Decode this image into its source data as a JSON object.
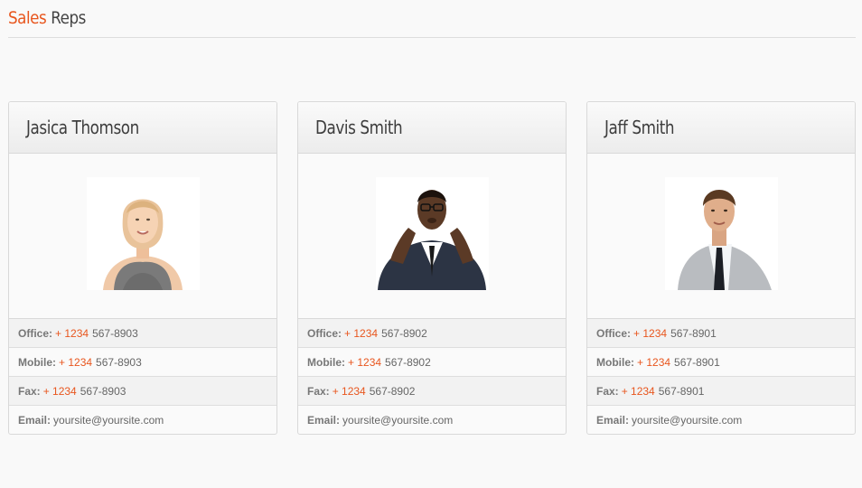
{
  "header": {
    "title_accent": "Sales",
    "title_rest": "Reps"
  },
  "labels": {
    "office": "Office:",
    "mobile": "Mobile:",
    "fax": "Fax:",
    "email": "Email:"
  },
  "reps": [
    {
      "name": "Jasica Thomson",
      "office": {
        "prefix": "+ 1234",
        "number": "567-8903"
      },
      "mobile": {
        "prefix": "+ 1234",
        "number": "567-8903"
      },
      "fax": {
        "prefix": "+ 1234",
        "number": "567-8903"
      },
      "email": "yoursite@yoursite.com"
    },
    {
      "name": "Davis Smith",
      "office": {
        "prefix": "+ 1234",
        "number": "567-8902"
      },
      "mobile": {
        "prefix": "+ 1234",
        "number": "567-8902"
      },
      "fax": {
        "prefix": "+ 1234",
        "number": "567-8902"
      },
      "email": "yoursite@yoursite.com"
    },
    {
      "name": "Jaff Smith",
      "office": {
        "prefix": "+ 1234",
        "number": "567-8901"
      },
      "mobile": {
        "prefix": "+ 1234",
        "number": "567-8901"
      },
      "fax": {
        "prefix": "+ 1234",
        "number": "567-8901"
      },
      "email": "yoursite@yoursite.com"
    }
  ],
  "colors": {
    "accent": "#e8561e",
    "text": "#666666",
    "heading": "#3d3d3d"
  }
}
